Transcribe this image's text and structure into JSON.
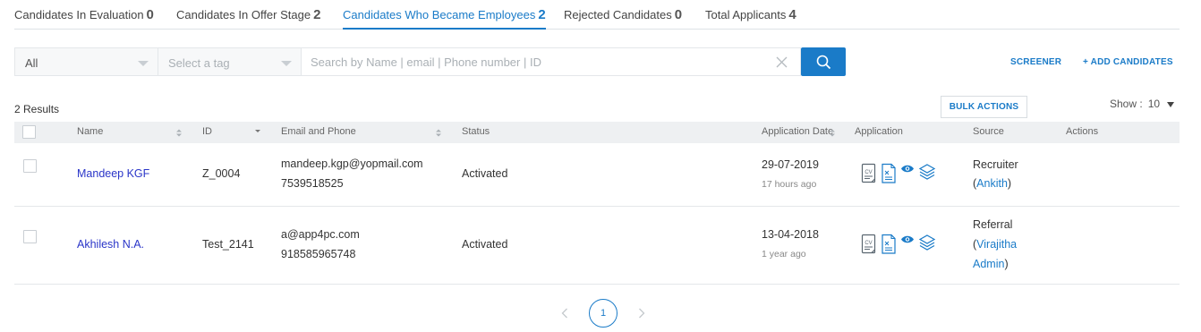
{
  "tabs": [
    {
      "label": "Candidates In Evaluation",
      "count": "0",
      "active": false
    },
    {
      "label": "Candidates In Offer Stage",
      "count": "2",
      "active": false
    },
    {
      "label": "Candidates Who Became Employees",
      "count": "2",
      "active": true
    },
    {
      "label": "Rejected Candidates",
      "count": "0",
      "active": false
    },
    {
      "label": "Total Applicants",
      "count": "4",
      "active": false
    }
  ],
  "filters": {
    "status_value": "All",
    "tag_placeholder": "Select a tag",
    "search_placeholder": "Search by Name | email | Phone number | ID"
  },
  "actions": {
    "screener": "SCREENER",
    "add_candidates": "+ ADD CANDIDATES",
    "bulk_actions": "BULK ACTIONS"
  },
  "results_text": "2 Results",
  "show": {
    "label": "Show :",
    "value": "10"
  },
  "table": {
    "headers": {
      "name": "Name",
      "id": "ID",
      "email_phone": "Email and Phone",
      "status": "Status",
      "application_date": "Application Date",
      "application": "Application",
      "source": "Source",
      "actions": "Actions"
    },
    "rows": [
      {
        "name": "Mandeep KGF",
        "id": "Z_0004",
        "email": "mandeep.kgp@yopmail.com",
        "phone": "7539518525",
        "status": "Activated",
        "date": "29-07-2019",
        "ago": "17 hours ago",
        "source_line1": "Recruiter",
        "source_open": "(",
        "source_name": "Ankith",
        "source_close": ")"
      },
      {
        "name": "Akhilesh N.A.",
        "id": "Test_2141",
        "email": "a@app4pc.com",
        "phone": "918585965748",
        "status": "Activated",
        "date": "13-04-2018",
        "ago": "1 year ago",
        "source_line1": "Referral",
        "source_open": "(",
        "source_name_1": "Virajitha",
        "source_name_2": "Admin",
        "source_close": ")"
      }
    ]
  },
  "pagination": {
    "current": "1"
  },
  "colors": {
    "accent": "#1a7bc8",
    "name_link": "#2a35c8",
    "header_bg": "#eef0f2"
  },
  "icons": [
    "chevron-down-icon",
    "clear-icon",
    "search-icon",
    "sort-icon",
    "cv-icon",
    "document-icon",
    "eye-icon",
    "layers-icon",
    "chevron-left-icon",
    "chevron-right-icon"
  ]
}
